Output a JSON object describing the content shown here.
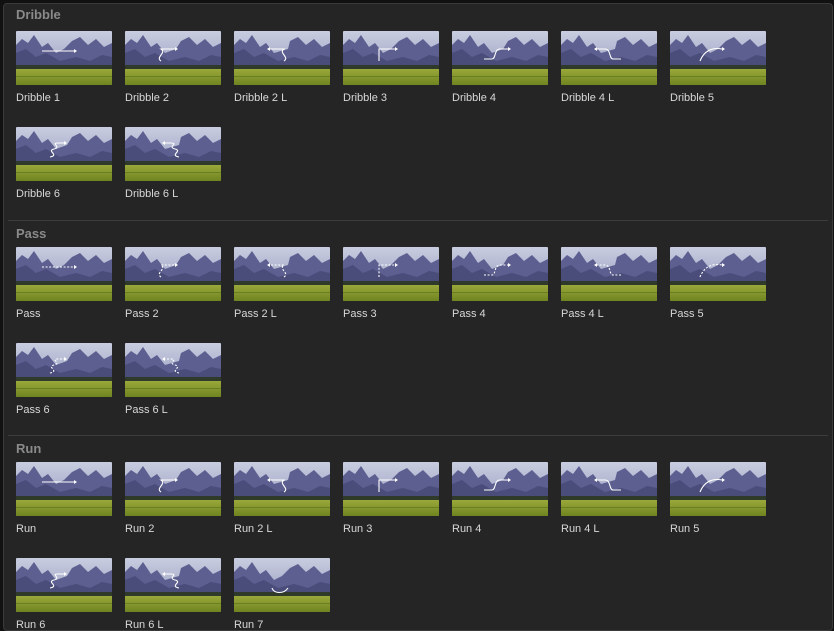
{
  "sections": [
    {
      "title": "Dribble",
      "items": [
        {
          "label": "Dribble 1",
          "path": "straight",
          "style": "solid"
        },
        {
          "label": "Dribble 2",
          "path": "s-right",
          "style": "solid"
        },
        {
          "label": "Dribble 2 L",
          "path": "s-left",
          "style": "solid"
        },
        {
          "label": "Dribble 3",
          "path": "turn-right",
          "style": "solid"
        },
        {
          "label": "Dribble 4",
          "path": "hook-right",
          "style": "solid"
        },
        {
          "label": "Dribble 4 L",
          "path": "hook-left",
          "style": "solid"
        },
        {
          "label": "Dribble 5",
          "path": "curve-right",
          "style": "solid"
        },
        {
          "label": "Dribble 6",
          "path": "zigzag-right",
          "style": "solid"
        },
        {
          "label": "Dribble 6 L",
          "path": "zigzag-left",
          "style": "solid"
        }
      ]
    },
    {
      "title": "Pass",
      "items": [
        {
          "label": "Pass",
          "path": "straight",
          "style": "dashed"
        },
        {
          "label": "Pass 2",
          "path": "s-right",
          "style": "dashed"
        },
        {
          "label": "Pass 2 L",
          "path": "s-left",
          "style": "dashed"
        },
        {
          "label": "Pass 3",
          "path": "turn-right",
          "style": "dashed"
        },
        {
          "label": "Pass 4",
          "path": "hook-right",
          "style": "dashed"
        },
        {
          "label": "Pass 4 L",
          "path": "hook-left",
          "style": "dashed"
        },
        {
          "label": "Pass 5",
          "path": "curve-right",
          "style": "dashed"
        },
        {
          "label": "Pass 6",
          "path": "zigzag-right",
          "style": "dashed"
        },
        {
          "label": "Pass 6 L",
          "path": "zigzag-left",
          "style": "dashed"
        }
      ]
    },
    {
      "title": "Run",
      "items": [
        {
          "label": "Run",
          "path": "straight",
          "style": "solid"
        },
        {
          "label": "Run 2",
          "path": "s-right",
          "style": "solid"
        },
        {
          "label": "Run 2 L",
          "path": "s-left",
          "style": "solid"
        },
        {
          "label": "Run 3",
          "path": "turn-right",
          "style": "solid"
        },
        {
          "label": "Run 4",
          "path": "hook-right",
          "style": "solid"
        },
        {
          "label": "Run 4 L",
          "path": "hook-left",
          "style": "solid"
        },
        {
          "label": "Run 5",
          "path": "curve-right",
          "style": "solid"
        },
        {
          "label": "Run 6",
          "path": "zigzag-right",
          "style": "solid"
        },
        {
          "label": "Run 6 L",
          "path": "zigzag-left",
          "style": "solid"
        },
        {
          "label": "Run 7",
          "path": "loop",
          "style": "solid"
        }
      ]
    }
  ],
  "colors": {
    "background": "#252525",
    "section_title": "#8a8a8a",
    "item_label": "#d8d8d8",
    "divider": "#3c3c3c",
    "arrow": "#ffffff"
  }
}
